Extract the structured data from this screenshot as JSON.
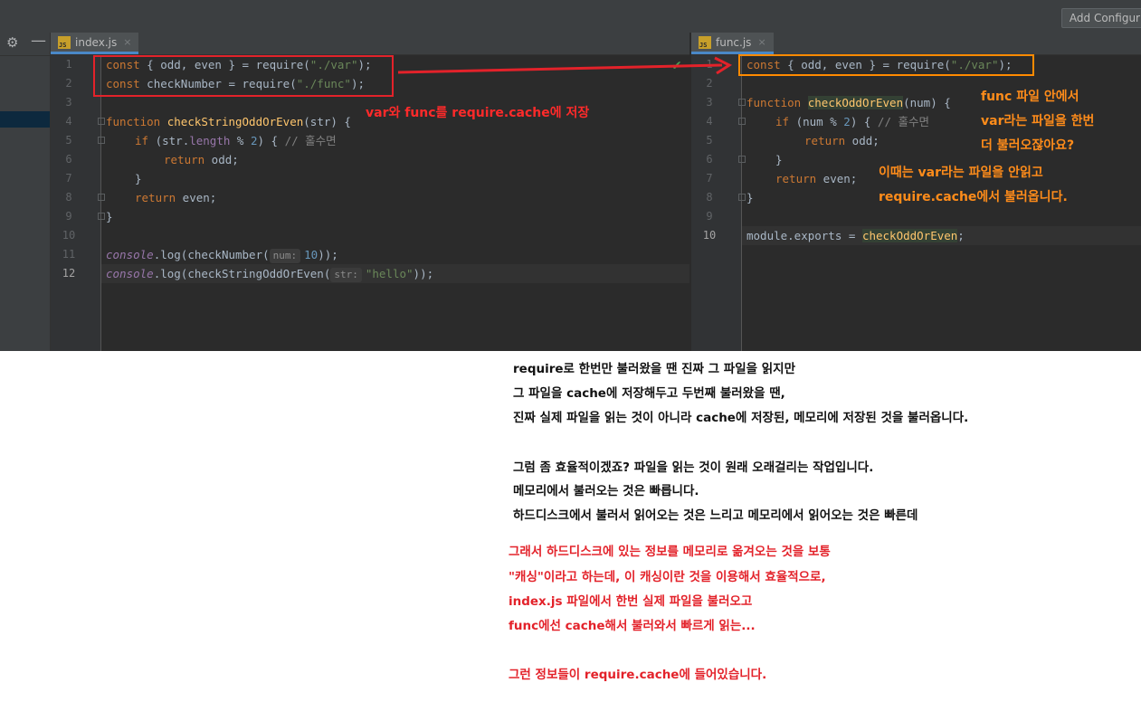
{
  "toolbar": {
    "add_configuration": "Add Configur"
  },
  "left_tab": {
    "label": "index.js",
    "icon": "JS",
    "close": "×"
  },
  "right_tab": {
    "label": "func.js",
    "icon": "JS",
    "close": "×"
  },
  "left_lines": [
    "1",
    "2",
    "3",
    "4",
    "5",
    "6",
    "7",
    "8",
    "9",
    "10",
    "11",
    "12"
  ],
  "right_lines": [
    "1",
    "2",
    "3",
    "4",
    "5",
    "6",
    "7",
    "8",
    "9",
    "10"
  ],
  "left_code": {
    "l1": {
      "a": "const",
      "b": " { odd, even } = require(",
      "c": "\"./var\"",
      "d": ");"
    },
    "l2": {
      "a": "const",
      "b": " checkNumber = require(",
      "c": "\"./func\"",
      "d": ");"
    },
    "l4": {
      "a": "function",
      "b": " checkStringOddOrEven",
      "c": "(str) {"
    },
    "l5": {
      "a": "if",
      "b": " (str.",
      "c": "length",
      "d": " % ",
      "e": "2",
      "f": ") { ",
      "g": "// 홀수면"
    },
    "l6": {
      "a": "return",
      "b": " odd;"
    },
    "l7": {
      "a": "}"
    },
    "l8": {
      "a": "return",
      "b": " even;"
    },
    "l9": {
      "a": "}"
    },
    "l11": {
      "a": "console",
      "b": ".log(checkNumber(",
      "hint": "num:",
      "c": "10",
      "d": "));"
    },
    "l12": {
      "a": "console",
      "b": ".log(checkStringOddOrEven(",
      "hint": "str:",
      "c": "\"hello\"",
      "d": "));"
    }
  },
  "right_code": {
    "l1": {
      "a": "const",
      "b": " { odd, even } = require(",
      "c": "\"./var\"",
      "d": ");"
    },
    "l3": {
      "a": "function",
      "b": "checkOddOrEven",
      "c": "(num) {"
    },
    "l4": {
      "a": "if",
      "b": " (num % ",
      "c": "2",
      "d": ") { ",
      "e": "// 홀수면"
    },
    "l5": {
      "a": "return",
      "b": " odd;"
    },
    "l6": {
      "a": "}"
    },
    "l7": {
      "a": "return",
      "b": " even;"
    },
    "l8": {
      "a": "}"
    },
    "l10": {
      "a": "module.exports = ",
      "b": "checkOddOrEven",
      "c": ";"
    }
  },
  "annotations": {
    "left_note": "var와 func를 require.cache에 저장",
    "right_note_1": "func 파일 안에서",
    "right_note_2": "var라는 파일을 한번",
    "right_note_3": "더 불러오잖아요?",
    "right_note_4": "이때는 var라는 파일을 안읽고",
    "right_note_5": "require.cache에서 불러옵니다."
  },
  "explanation": {
    "black": [
      "require로 한번만 불러왔을 땐 진짜 그 파일을 읽지만",
      "그 파일을 cache에 저장해두고 두번째 불러왔을 땐,",
      "진짜 실제 파일을 읽는 것이 아니라 cache에 저장된, 메모리에 저장된 것을 불러옵니다.",
      "",
      "그럼 좀 효율적이겠죠? 파일을 읽는 것이 원래 오래걸리는 작업입니다.",
      "메모리에서 불러오는 것은 빠릅니다.",
      "하드디스크에서 불러서 읽어오는 것은 느리고 메모리에서 읽어오는 것은 빠른데"
    ],
    "red": [
      "그래서 하드디스크에 있는 정보를 메모리로 옮겨오는 것을 보통",
      "\"캐싱\"이라고 하는데, 이 캐싱이란 것을 이용해서 효율적으로,",
      "index.js 파일에서 한번 실제 파일을 불러오고",
      "func에선 cache해서 불러와서 빠르게 읽는...",
      "",
      "그런 정보들이 require.cache에 들어있습니다."
    ]
  },
  "colors": {
    "annotation_red": "#e3222a",
    "annotation_orange": "#ff8a00"
  }
}
